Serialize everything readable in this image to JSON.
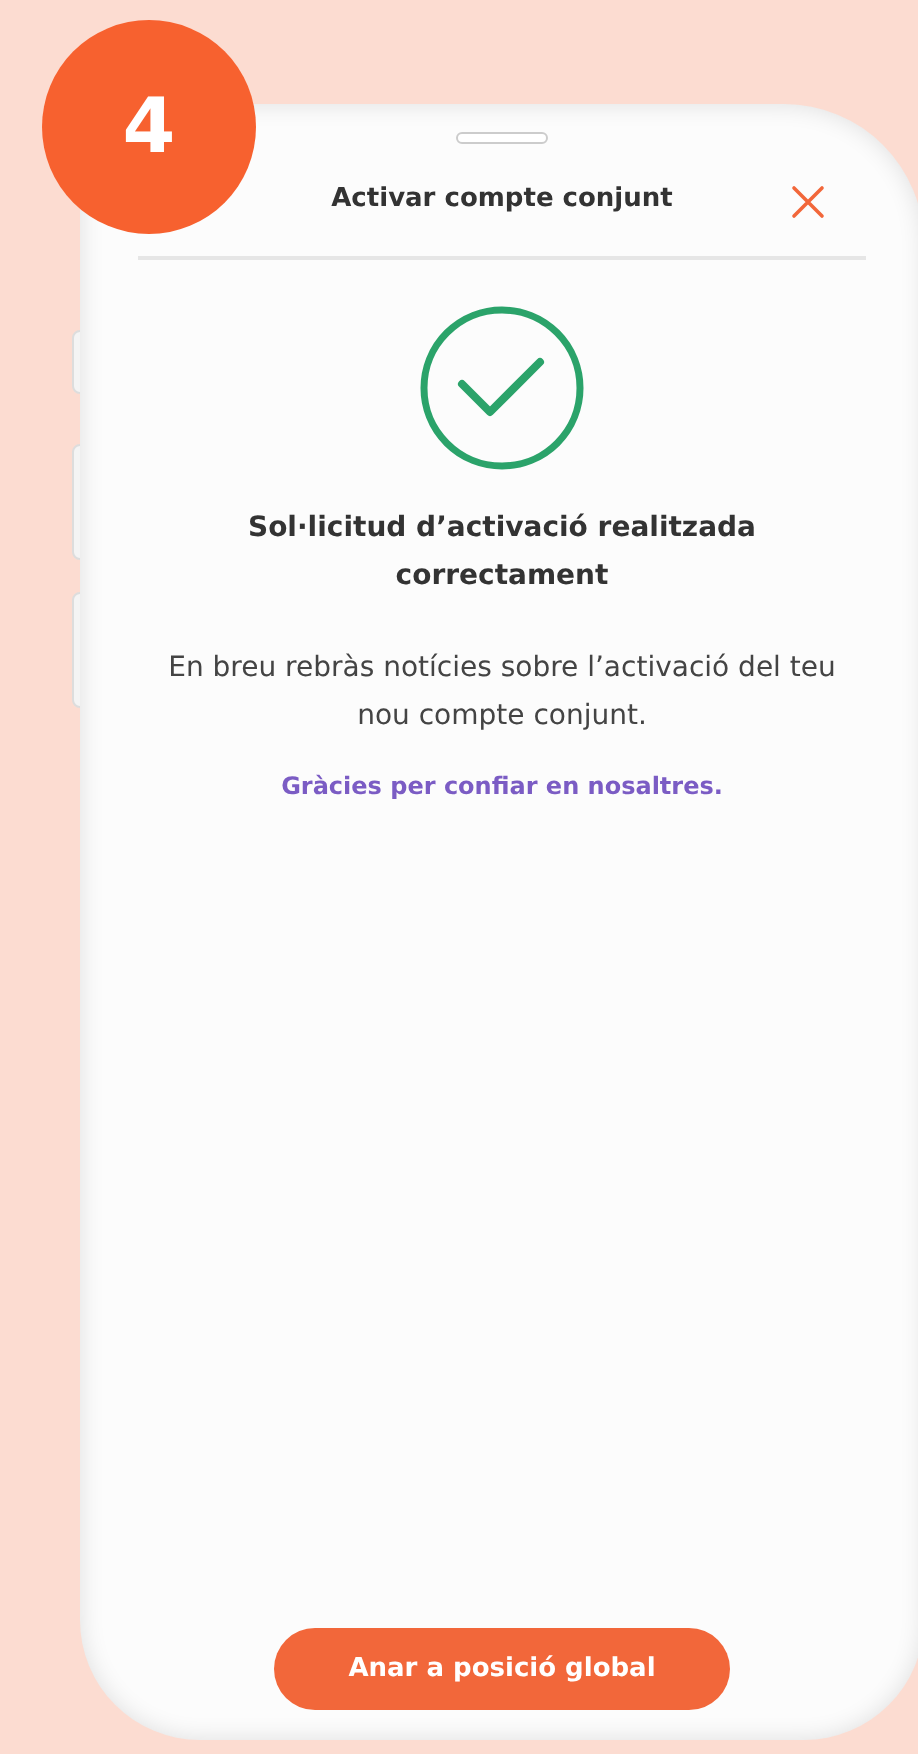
{
  "step_badge": "4",
  "header": {
    "title": "Activar compte conjunt"
  },
  "message": {
    "heading": "Sol·licitud d’activació realitzada correctament",
    "body": "En breu rebràs notícies sobre l’activació del teu nou compte conjunt.",
    "thanks": "Gràcies per confiar en nosaltres."
  },
  "buttons": [
    "Anar a posició global"
  ]
}
